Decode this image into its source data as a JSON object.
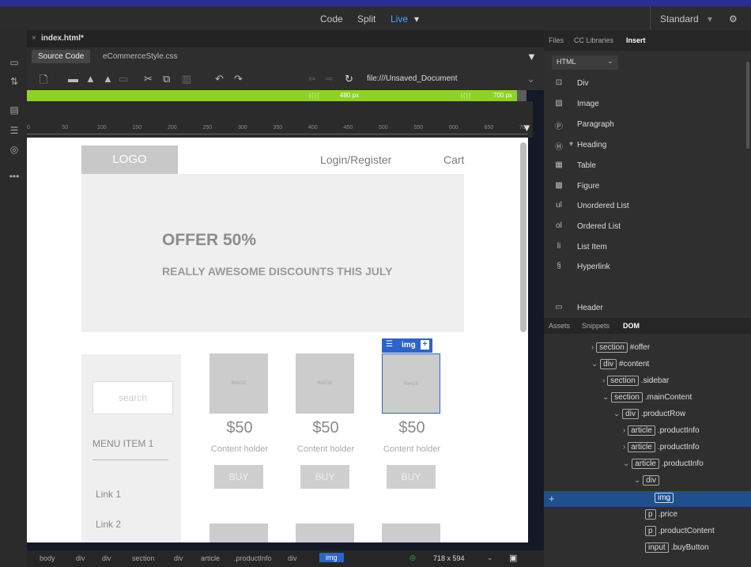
{
  "menubar": {
    "code": "Code",
    "split": "Split",
    "live": "Live",
    "workspace": "Standard"
  },
  "tabs": {
    "file": "index.html*"
  },
  "related": {
    "source": "Source Code",
    "css": "eCommerceStyle.css"
  },
  "toolbar": {
    "address": "file:///Unsaved_Document"
  },
  "mediaquery": {
    "q1": "480 px",
    "q2": "700 px"
  },
  "ruler": {
    "ticks": [
      "0",
      "50",
      "100",
      "150",
      "200",
      "250",
      "300",
      "350",
      "400",
      "450",
      "500",
      "550",
      "600",
      "650",
      "700"
    ]
  },
  "page": {
    "logo": "LOGO",
    "login": "Login/Register",
    "cart": "Cart",
    "offer_title": "OFFER 50%",
    "offer_sub": "REALLY AWESOME DISCOUNTS THIS JULY",
    "search_placeholder": "search",
    "menu_item": "MENU ITEM 1",
    "links": [
      "Link 1",
      "Link 2"
    ],
    "products": [
      {
        "img": "IMAGE",
        "price": "$50",
        "content": "Content holder",
        "buy": "BUY"
      },
      {
        "img": "IMAGE",
        "price": "$50",
        "content": "Content holder",
        "buy": "BUY"
      },
      {
        "img": "IMAGE",
        "price": "$50",
        "content": "Content holder",
        "buy": "BUY"
      }
    ],
    "selection_label": "img"
  },
  "panels": {
    "top_tabs": [
      "Files",
      "CC Libraries",
      "Insert"
    ],
    "html_select": "HTML",
    "insert_items": [
      "Div",
      "Image",
      "Paragraph",
      "Heading",
      "Table",
      "Figure",
      "Unordered List",
      "Ordered List",
      "List Item",
      "Hyperlink",
      "Header"
    ],
    "bottom_tabs": [
      "Assets",
      "Snippets",
      "DOM"
    ],
    "dom": [
      {
        "tag": "section",
        "label": "#offer"
      },
      {
        "tag": "div",
        "label": "#content"
      },
      {
        "tag": "section",
        "label": ".sidebar"
      },
      {
        "tag": "section",
        "label": ".mainContent"
      },
      {
        "tag": "div",
        "label": ".productRow"
      },
      {
        "tag": "article",
        "label": ".productInfo"
      },
      {
        "tag": "article",
        "label": ".productInfo"
      },
      {
        "tag": "article",
        "label": ".productInfo"
      },
      {
        "tag": "div",
        "label": ""
      },
      {
        "tag": "img",
        "label": ""
      },
      {
        "tag": "p",
        "label": ".price"
      },
      {
        "tag": "p",
        "label": ".productContent"
      },
      {
        "tag": "input",
        "label": ".buyButton"
      }
    ]
  },
  "status": {
    "crumbs": [
      "body",
      "div",
      "div",
      "section",
      "div",
      "article",
      ".productInfo",
      "div",
      "img"
    ],
    "size": "718 x 594"
  },
  "colors": {
    "live": "#4aa3ff",
    "mq_green": "#8fd12a",
    "selection": "#2e63c7",
    "dom_selected": "#1f4f8c"
  }
}
